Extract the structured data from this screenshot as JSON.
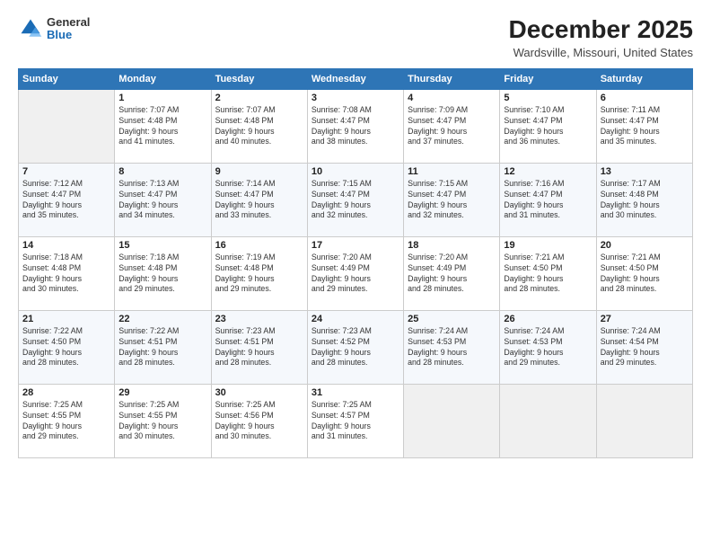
{
  "logo": {
    "general": "General",
    "blue": "Blue"
  },
  "header": {
    "title": "December 2025",
    "location": "Wardsville, Missouri, United States"
  },
  "calendar": {
    "days_of_week": [
      "Sunday",
      "Monday",
      "Tuesday",
      "Wednesday",
      "Thursday",
      "Friday",
      "Saturday"
    ],
    "weeks": [
      [
        {
          "day": "",
          "info": ""
        },
        {
          "day": "1",
          "info": "Sunrise: 7:07 AM\nSunset: 4:48 PM\nDaylight: 9 hours\nand 41 minutes."
        },
        {
          "day": "2",
          "info": "Sunrise: 7:07 AM\nSunset: 4:48 PM\nDaylight: 9 hours\nand 40 minutes."
        },
        {
          "day": "3",
          "info": "Sunrise: 7:08 AM\nSunset: 4:47 PM\nDaylight: 9 hours\nand 38 minutes."
        },
        {
          "day": "4",
          "info": "Sunrise: 7:09 AM\nSunset: 4:47 PM\nDaylight: 9 hours\nand 37 minutes."
        },
        {
          "day": "5",
          "info": "Sunrise: 7:10 AM\nSunset: 4:47 PM\nDaylight: 9 hours\nand 36 minutes."
        },
        {
          "day": "6",
          "info": "Sunrise: 7:11 AM\nSunset: 4:47 PM\nDaylight: 9 hours\nand 35 minutes."
        }
      ],
      [
        {
          "day": "7",
          "info": "Sunrise: 7:12 AM\nSunset: 4:47 PM\nDaylight: 9 hours\nand 35 minutes."
        },
        {
          "day": "8",
          "info": "Sunrise: 7:13 AM\nSunset: 4:47 PM\nDaylight: 9 hours\nand 34 minutes."
        },
        {
          "day": "9",
          "info": "Sunrise: 7:14 AM\nSunset: 4:47 PM\nDaylight: 9 hours\nand 33 minutes."
        },
        {
          "day": "10",
          "info": "Sunrise: 7:15 AM\nSunset: 4:47 PM\nDaylight: 9 hours\nand 32 minutes."
        },
        {
          "day": "11",
          "info": "Sunrise: 7:15 AM\nSunset: 4:47 PM\nDaylight: 9 hours\nand 32 minutes."
        },
        {
          "day": "12",
          "info": "Sunrise: 7:16 AM\nSunset: 4:47 PM\nDaylight: 9 hours\nand 31 minutes."
        },
        {
          "day": "13",
          "info": "Sunrise: 7:17 AM\nSunset: 4:48 PM\nDaylight: 9 hours\nand 30 minutes."
        }
      ],
      [
        {
          "day": "14",
          "info": "Sunrise: 7:18 AM\nSunset: 4:48 PM\nDaylight: 9 hours\nand 30 minutes."
        },
        {
          "day": "15",
          "info": "Sunrise: 7:18 AM\nSunset: 4:48 PM\nDaylight: 9 hours\nand 29 minutes."
        },
        {
          "day": "16",
          "info": "Sunrise: 7:19 AM\nSunset: 4:48 PM\nDaylight: 9 hours\nand 29 minutes."
        },
        {
          "day": "17",
          "info": "Sunrise: 7:20 AM\nSunset: 4:49 PM\nDaylight: 9 hours\nand 29 minutes."
        },
        {
          "day": "18",
          "info": "Sunrise: 7:20 AM\nSunset: 4:49 PM\nDaylight: 9 hours\nand 28 minutes."
        },
        {
          "day": "19",
          "info": "Sunrise: 7:21 AM\nSunset: 4:50 PM\nDaylight: 9 hours\nand 28 minutes."
        },
        {
          "day": "20",
          "info": "Sunrise: 7:21 AM\nSunset: 4:50 PM\nDaylight: 9 hours\nand 28 minutes."
        }
      ],
      [
        {
          "day": "21",
          "info": "Sunrise: 7:22 AM\nSunset: 4:50 PM\nDaylight: 9 hours\nand 28 minutes."
        },
        {
          "day": "22",
          "info": "Sunrise: 7:22 AM\nSunset: 4:51 PM\nDaylight: 9 hours\nand 28 minutes."
        },
        {
          "day": "23",
          "info": "Sunrise: 7:23 AM\nSunset: 4:51 PM\nDaylight: 9 hours\nand 28 minutes."
        },
        {
          "day": "24",
          "info": "Sunrise: 7:23 AM\nSunset: 4:52 PM\nDaylight: 9 hours\nand 28 minutes."
        },
        {
          "day": "25",
          "info": "Sunrise: 7:24 AM\nSunset: 4:53 PM\nDaylight: 9 hours\nand 28 minutes."
        },
        {
          "day": "26",
          "info": "Sunrise: 7:24 AM\nSunset: 4:53 PM\nDaylight: 9 hours\nand 29 minutes."
        },
        {
          "day": "27",
          "info": "Sunrise: 7:24 AM\nSunset: 4:54 PM\nDaylight: 9 hours\nand 29 minutes."
        }
      ],
      [
        {
          "day": "28",
          "info": "Sunrise: 7:25 AM\nSunset: 4:55 PM\nDaylight: 9 hours\nand 29 minutes."
        },
        {
          "day": "29",
          "info": "Sunrise: 7:25 AM\nSunset: 4:55 PM\nDaylight: 9 hours\nand 30 minutes."
        },
        {
          "day": "30",
          "info": "Sunrise: 7:25 AM\nSunset: 4:56 PM\nDaylight: 9 hours\nand 30 minutes."
        },
        {
          "day": "31",
          "info": "Sunrise: 7:25 AM\nSunset: 4:57 PM\nDaylight: 9 hours\nand 31 minutes."
        },
        {
          "day": "",
          "info": ""
        },
        {
          "day": "",
          "info": ""
        },
        {
          "day": "",
          "info": ""
        }
      ]
    ]
  }
}
